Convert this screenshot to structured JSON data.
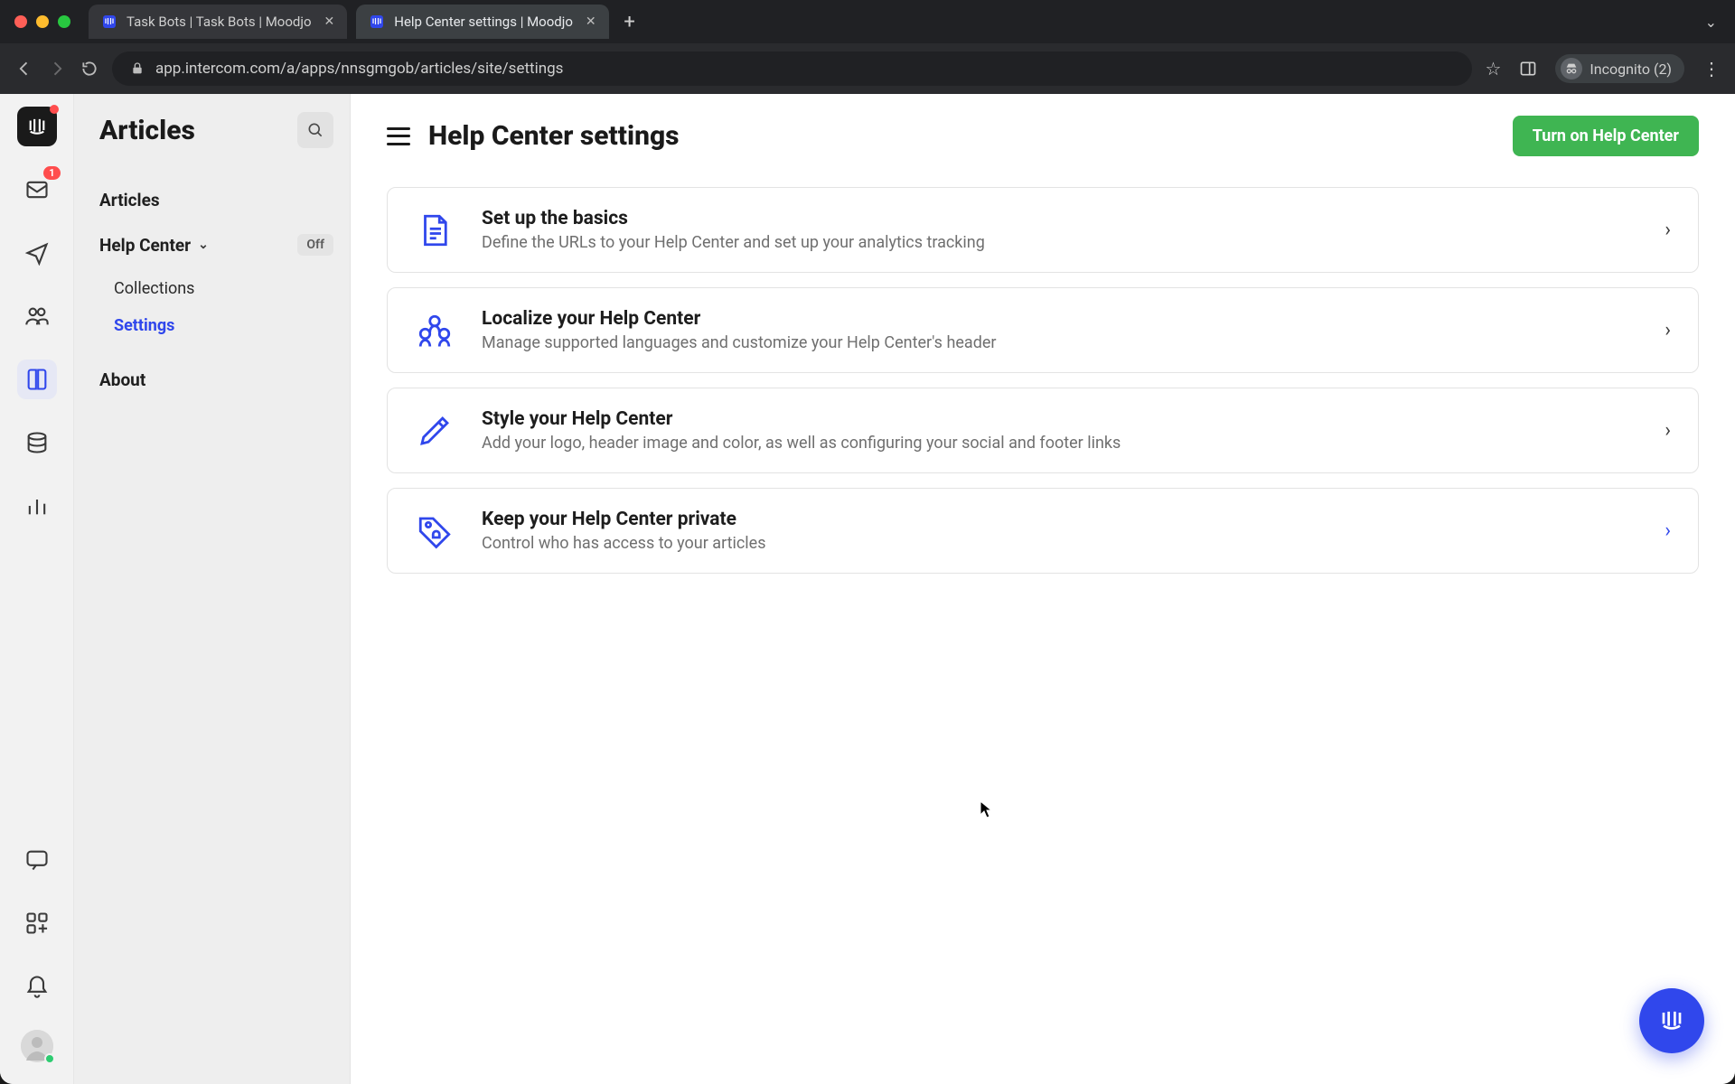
{
  "browser": {
    "tabs": [
      {
        "title": "Task Bots | Task Bots | Moodjo"
      },
      {
        "title": "Help Center settings | Moodjo"
      }
    ],
    "new_tab": "+",
    "url": "app.intercom.com/a/apps/nnsgmgob/articles/site/settings",
    "incognito_label": "Incognito (2)"
  },
  "rail": {
    "inbox_badge": "1"
  },
  "sidebar": {
    "title": "Articles",
    "nav_articles": "Articles",
    "nav_helpcenter": "Help Center",
    "helpcenter_status": "Off",
    "sub_collections": "Collections",
    "sub_settings": "Settings",
    "nav_about": "About"
  },
  "main": {
    "heading": "Help Center settings",
    "cta": "Turn on Help Center",
    "cards": [
      {
        "title": "Set up the basics",
        "desc": "Define the URLs to your Help Center and set up your analytics tracking",
        "icon": "doc"
      },
      {
        "title": "Localize your Help Center",
        "desc": "Manage supported languages and customize your Help Center's header",
        "icon": "people"
      },
      {
        "title": "Style your Help Center",
        "desc": "Add your logo, header image and color, as well as configuring your social and footer links",
        "icon": "pencil"
      },
      {
        "title": "Keep your Help Center private",
        "desc": "Control who has access to your articles",
        "icon": "tag"
      }
    ]
  },
  "colors": {
    "accent": "#3047ec",
    "cta_green": "#3fb552"
  }
}
